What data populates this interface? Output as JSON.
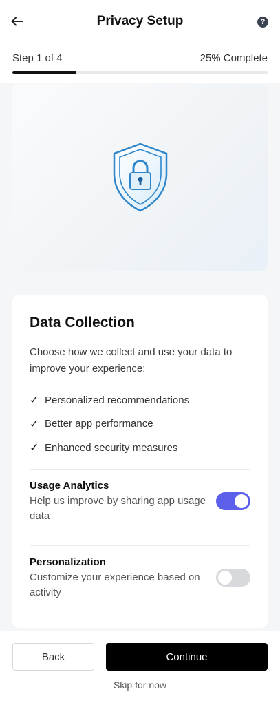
{
  "header": {
    "title": "Privacy Setup",
    "back_icon": "arrow-left-icon",
    "help_icon": "question-circle-icon",
    "help_glyph": "?"
  },
  "progress": {
    "step_label": "Step 1 of 4",
    "complete_label": "25% Complete",
    "fraction": 0.25
  },
  "hero": {
    "icon": "shield-lock-icon"
  },
  "data_collection": {
    "title": "Data Collection",
    "description": "Choose how we collect and use your data to improve your experience:",
    "benefits": [
      "Personalized recommendations",
      "Better app performance",
      "Enhanced security measures"
    ]
  },
  "settings": {
    "usage_analytics": {
      "title": "Usage Analytics",
      "description": "Help us improve by sharing app usage data",
      "enabled": true
    },
    "personalization": {
      "title": "Personalization",
      "description": "Customize your experience based on activity",
      "enabled": false
    }
  },
  "footer": {
    "back_label": "Back",
    "continue_label": "Continue",
    "skip_label": "Skip for now"
  },
  "colors": {
    "accent": "#5b5fe9",
    "shield": "#2f86c9",
    "primary_button": "#000000"
  }
}
